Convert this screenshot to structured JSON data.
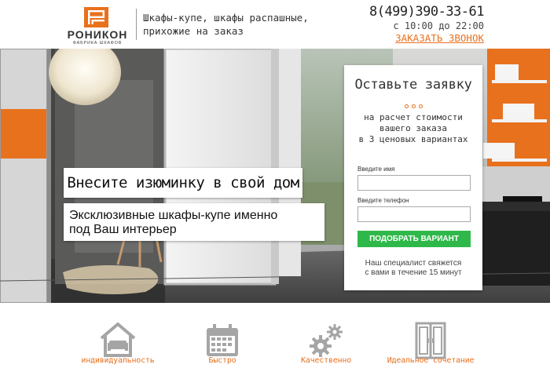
{
  "header": {
    "logo_name": "РОНИКОН",
    "logo_subtitle": "ФАБРИКА ШКАФОВ",
    "tagline_line1": "Шкафы-купе, шкафы распашные,",
    "tagline_line2": "прихожие на заказ",
    "phone": "8(499)390-33-61",
    "hours": "с 10:00 до 22:00",
    "callback_label": "ЗАКАЗАТЬ ЗВОНОК"
  },
  "hero": {
    "title": "Внесите изюминку в свой дом",
    "subtitle_line1": "Эксклюзивные шкафы-купе именно",
    "subtitle_line2": "под Ваш интерьер"
  },
  "form": {
    "title": "Оставьте заявку",
    "desc_line1": "на расчет стоимости",
    "desc_line2": "вашего заказа",
    "desc_line3": "в 3 ценовых вариантах",
    "name_label": "Введите имя",
    "name_value": "",
    "phone_label": "Введите телефон",
    "phone_value": "",
    "submit_label": "ПОДОБРАТЬ ВАРИАНТ",
    "note_line1": "Наш специалист свяжется",
    "note_line2": "с вами в течение 15 минут"
  },
  "features": [
    {
      "label": "индивидуальность",
      "icon": "house-sofa-icon"
    },
    {
      "label": "Быстро",
      "icon": "calendar-icon"
    },
    {
      "label": "Качественно",
      "icon": "gears-icon"
    },
    {
      "label": "Идеальное сочетание",
      "icon": "wardrobe-icon"
    }
  ],
  "colors": {
    "accent": "#e8711d",
    "button_green": "#2fb84a",
    "icon_gray": "#a5a5a5"
  }
}
